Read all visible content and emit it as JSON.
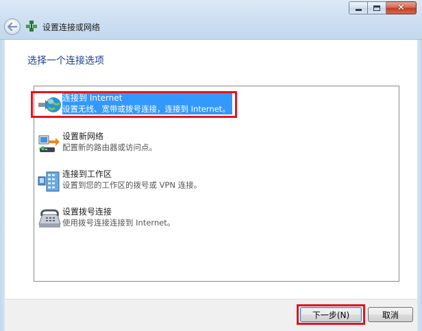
{
  "window": {
    "title": "设置连接或网络",
    "caption_buttons": {
      "minimize": "minimize-icon",
      "maximize": "maximize-icon",
      "close": "close-icon"
    }
  },
  "heading": "选择一个连接选项",
  "options": [
    {
      "title": "连接到 Internet",
      "description": "设置无线、宽带或拨号连接，连接到 Internet。",
      "icon": "globe-network-icon",
      "selected": true
    },
    {
      "title": "设置新网络",
      "description": "配置新的路由器或访问点。",
      "icon": "router-setup-icon",
      "selected": false
    },
    {
      "title": "连接到工作区",
      "description": "设置到您的工作区的拨号或 VPN 连接。",
      "icon": "workplace-building-icon",
      "selected": false
    },
    {
      "title": "设置拨号连接",
      "description": "使用拨号连接连接到 Internet。",
      "icon": "telephone-modem-icon",
      "selected": false
    }
  ],
  "buttons": {
    "next": "下一步(N)",
    "cancel": "取消"
  },
  "colors": {
    "heading": "#1e3f8a",
    "selection": "#3399ff",
    "highlight_outline": "#e3131c"
  }
}
